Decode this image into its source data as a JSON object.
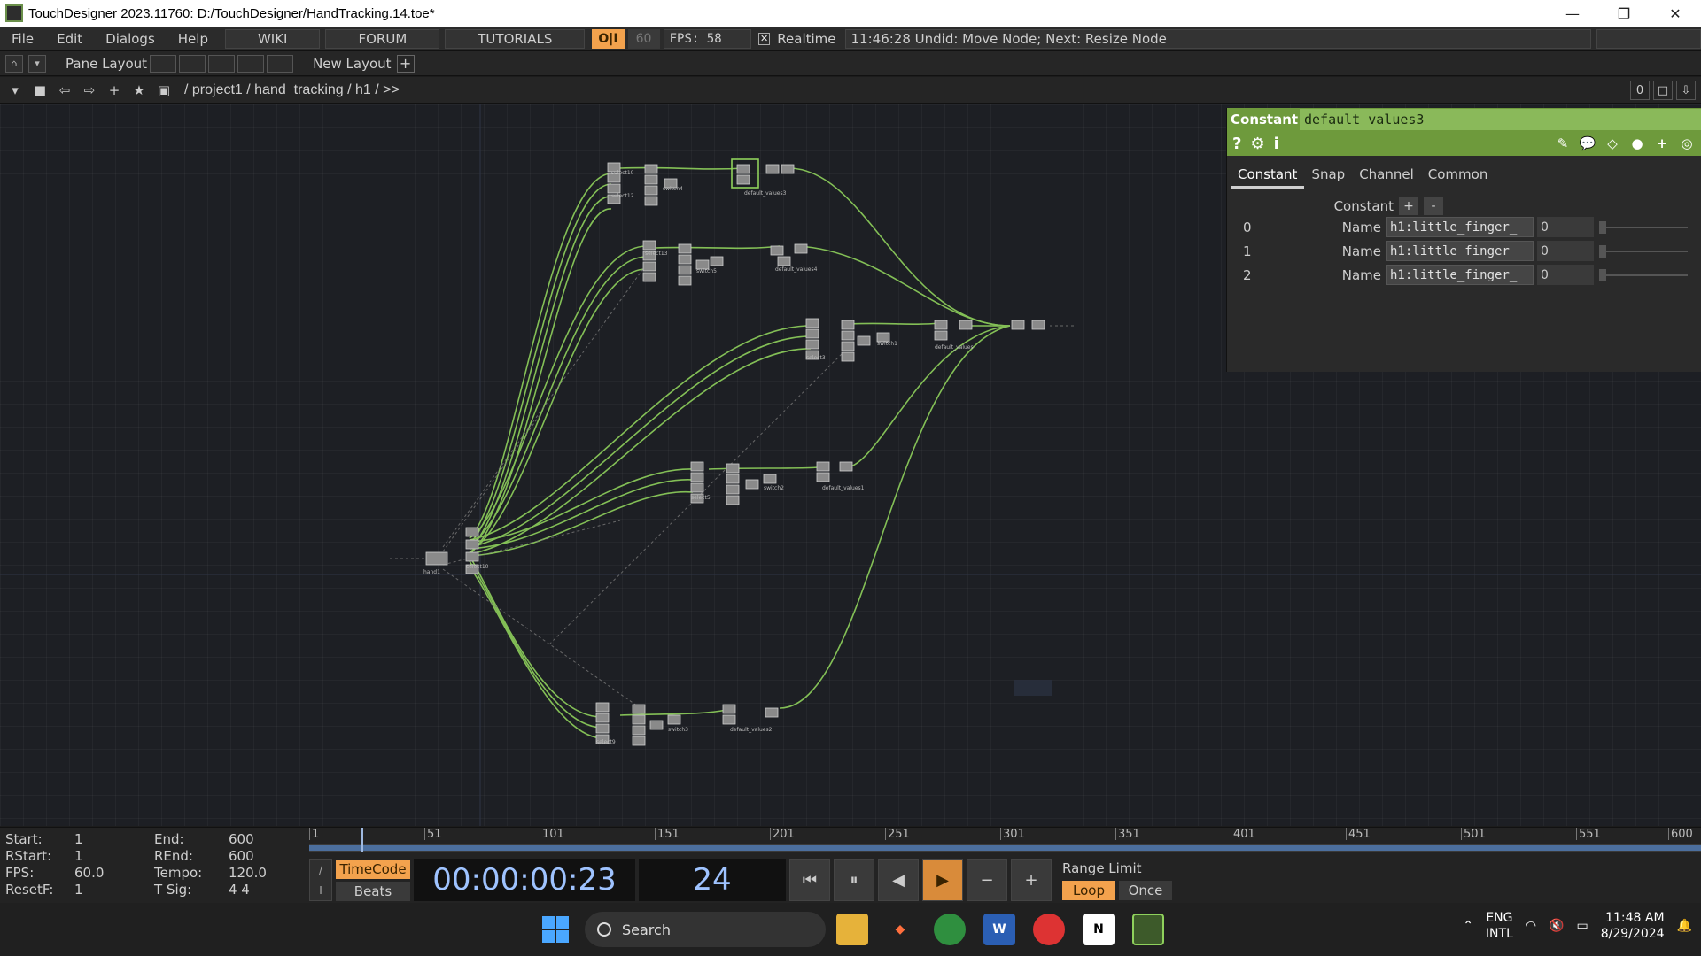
{
  "window": {
    "title": "TouchDesigner 2023.11760: D:/TouchDesigner/HandTracking.14.toe*",
    "minimize": "—",
    "restore": "❐",
    "close": "✕"
  },
  "menu": {
    "items": [
      "File",
      "Edit",
      "Dialogs",
      "Help"
    ],
    "wiki": "WIKI",
    "forum": "FORUM",
    "tutorials": "TUTORIALS",
    "oi": "O|I",
    "fps_cap": "60",
    "fps_text": "FPS:  58",
    "realtime_check": "✕",
    "realtime_label": "Realtime",
    "status": "11:46:28 Undid: Move Node; Next: Resize Node"
  },
  "layout": {
    "pane_layout": "Pane Layout",
    "new_layout": "New Layout",
    "add": "+"
  },
  "path": {
    "breadcrumb": "/ project1 / hand_tracking / h1 / >>",
    "right_value": "0"
  },
  "param_panel": {
    "op_type": "Constant",
    "op_name": "default_values3",
    "tabs": [
      "Constant",
      "Snap",
      "Channel",
      "Common"
    ],
    "section_label": "Constant",
    "add": "+",
    "remove": "-",
    "rows": [
      {
        "index": "0",
        "label": "Name",
        "value": "h1:little_finger_",
        "number": "0"
      },
      {
        "index": "1",
        "label": "Name",
        "value": "h1:little_finger_",
        "number": "0"
      },
      {
        "index": "2",
        "label": "Name",
        "value": "h1:little_finger_",
        "number": "0"
      }
    ]
  },
  "timeline": {
    "info": [
      {
        "k": "Start:",
        "v": "1",
        "k2": "End:",
        "v2": "600"
      },
      {
        "k": "RStart:",
        "v": "1",
        "k2": "REnd:",
        "v2": "600"
      },
      {
        "k": "FPS:",
        "v": "60.0",
        "k2": "Tempo:",
        "v2": "120.0"
      },
      {
        "k": "ResetF:",
        "v": "1",
        "k2": "T Sig:",
        "v2": "4     4"
      }
    ],
    "ruler_ticks": [
      "1",
      "51",
      "101",
      "151",
      "201",
      "251",
      "301",
      "351",
      "401",
      "451",
      "501",
      "551",
      "600"
    ],
    "current_frame_fraction": 0.038,
    "timecode_mode": "TimeCode",
    "beats_mode": "Beats",
    "timecode": "00:00:00:23",
    "frame": "24",
    "range_limit": "Range Limit",
    "loop": "Loop",
    "once": "Once"
  },
  "taskbar": {
    "search": "Search",
    "lang_1": "ENG",
    "lang_2": "INTL",
    "time": "11:48 AM",
    "date": "8/29/2024"
  },
  "colors": {
    "accent_green": "#6e9a3c",
    "wire_green": "#8fd15c",
    "orange": "#f3a24d",
    "timecode_blue": "#9fc3ff"
  }
}
